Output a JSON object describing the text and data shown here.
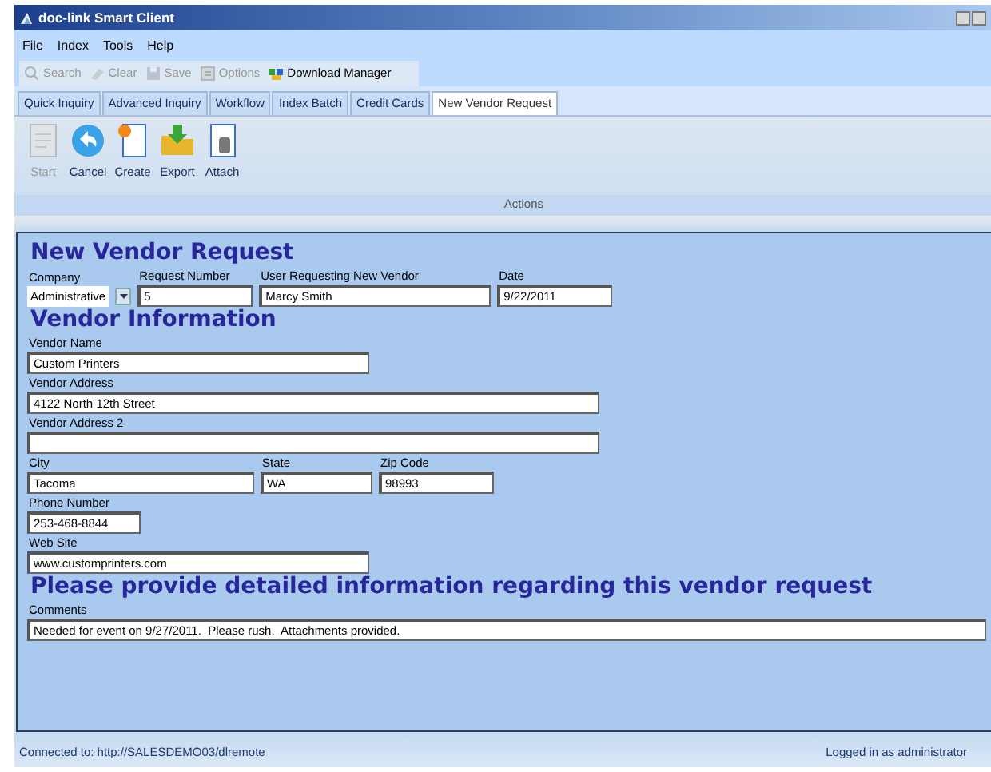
{
  "window": {
    "title": "doc-link Smart Client"
  },
  "menu": [
    {
      "label": "File"
    },
    {
      "label": "Index"
    },
    {
      "label": "Tools"
    },
    {
      "label": "Help"
    }
  ],
  "toolbar": [
    {
      "label": "Search",
      "disabled": true
    },
    {
      "label": "Clear",
      "disabled": true
    },
    {
      "label": "Save",
      "disabled": true
    },
    {
      "label": "Options",
      "disabled": true
    },
    {
      "label": "Download Manager",
      "disabled": false
    }
  ],
  "tabs": [
    {
      "label": "Quick Inquiry",
      "selected": false
    },
    {
      "label": "Advanced Inquiry",
      "selected": false
    },
    {
      "label": "Workflow",
      "selected": false
    },
    {
      "label": "Index Batch",
      "selected": false
    },
    {
      "label": "Credit Cards",
      "selected": false
    },
    {
      "label": "New Vendor Request",
      "selected": true
    }
  ],
  "actions": {
    "buttons": [
      {
        "label": "Start",
        "disabled": true
      },
      {
        "label": "Cancel",
        "disabled": false
      },
      {
        "label": "Create",
        "disabled": false
      },
      {
        "label": "Export",
        "disabled": false
      },
      {
        "label": "Attach",
        "disabled": false
      }
    ],
    "group_label": "Actions"
  },
  "form": [
    {
      "kind": "heading",
      "text": "New Vendor Request"
    },
    {
      "kind": "row",
      "fields": [
        {
          "label": "Company",
          "value": "Administrative",
          "kind": "dropdown"
        },
        {
          "label": "Request Number",
          "value": "5",
          "kind": "text"
        },
        {
          "label": "User Requesting New Vendor",
          "value": "Marcy Smith",
          "kind": "text"
        },
        {
          "label": "Date",
          "value": "9/22/2011",
          "kind": "text"
        }
      ]
    },
    {
      "kind": "heading",
      "text": "Vendor Information"
    },
    {
      "kind": "row",
      "fields": [
        {
          "label": "Vendor Name",
          "value": "Custom Printers",
          "kind": "text"
        }
      ]
    },
    {
      "kind": "row",
      "fields": [
        {
          "label": "Vendor Address",
          "value": "4122 North 12th Street",
          "kind": "text"
        }
      ]
    },
    {
      "kind": "row",
      "fields": [
        {
          "label": "Vendor Address 2",
          "kind": "text"
        }
      ]
    },
    {
      "kind": "row",
      "fields": [
        {
          "label": "City",
          "value": "Tacoma",
          "kind": "text"
        },
        {
          "label": "State",
          "value": "WA",
          "kind": "text"
        },
        {
          "label": "Zip Code",
          "value": "98993",
          "kind": "text"
        }
      ]
    },
    {
      "kind": "row",
      "fields": [
        {
          "label": "Phone Number",
          "value": "253-468-8844",
          "kind": "text"
        }
      ]
    },
    {
      "kind": "row",
      "fields": [
        {
          "label": "Web Site",
          "value": "www.customprinters.com",
          "kind": "text"
        }
      ]
    },
    {
      "kind": "heading",
      "text": "Please provide detailed information regarding this vendor request"
    },
    {
      "kind": "row",
      "fields": [
        {
          "label": "Comments",
          "value": "Needed for event on 9/27/2011.  Please rush.  Attachments provided.",
          "kind": "text"
        }
      ]
    }
  ],
  "status_bar": {
    "connection": "Connected to:  http://SALESDEMO03/dlremote",
    "user": "Logged in as administrator"
  }
}
